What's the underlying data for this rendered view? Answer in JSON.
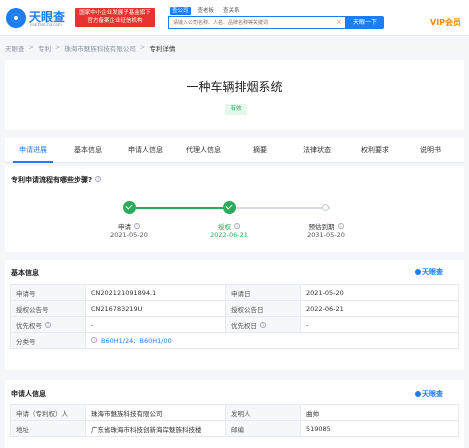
{
  "header": {
    "logo_text": "天眼查",
    "logo_sub": "TianYanCha.com",
    "promo_line1": "国家中小企业发展子基金旗下",
    "promo_line2": "官方备案企业征信机构",
    "search_tabs": [
      "查公司",
      "查老板",
      "查关系"
    ],
    "search_placeholder": "请输入公司名称、人名、品牌名称等关键词",
    "clear_icon": "×",
    "search_button": "天眼一下",
    "vip_label": "VIP会员"
  },
  "breadcrumb": {
    "items": [
      "天眼查",
      "专利",
      "珠海市魅族科技有限公司",
      "专利详情"
    ],
    "sep": ">"
  },
  "patent": {
    "title": "一种车辆排烟系统",
    "status": "有效"
  },
  "tabs": [
    "申请进展",
    "基本信息",
    "申请人信息",
    "代理人信息",
    "摘要",
    "法律状态",
    "权利要求",
    "说明书"
  ],
  "progress": {
    "title": "专利申请流程有哪些步骤?",
    "help": "?",
    "steps": [
      {
        "label": "申请",
        "date": "2021-05-20",
        "done": true
      },
      {
        "label": "授权",
        "date": "2022-06-21",
        "done": true
      },
      {
        "label": "预估到期",
        "date": "2031-05-20",
        "done": false
      }
    ]
  },
  "basic_info": {
    "title": "基本信息",
    "brand": "天眼查",
    "rows": [
      [
        "申请号",
        "CN202121091894.1",
        "申请日",
        "2021-05-20"
      ],
      [
        "授权公告号",
        "CN216783219U",
        "授权公告日",
        "2022-06-21"
      ],
      [
        "优先权号",
        "-",
        "优先权日",
        "-"
      ]
    ],
    "class_label": "分类号",
    "classes": [
      "B60H1/24;",
      "B60H1/00"
    ]
  },
  "applicant_info": {
    "title": "申请人信息",
    "brand": "天眼查",
    "rows": [
      [
        "申请（专利权）人",
        "珠海市魅族科技有限公司",
        "发明人",
        "曲帅"
      ],
      [
        "地址",
        "广东省珠海市科技创新海岸魅族科技楼",
        "邮编",
        "519085"
      ]
    ]
  },
  "colors": {
    "accent": "#1d7cf2",
    "success": "#2aab57",
    "vip": "#f08a00",
    "promo": "#e8322e"
  }
}
